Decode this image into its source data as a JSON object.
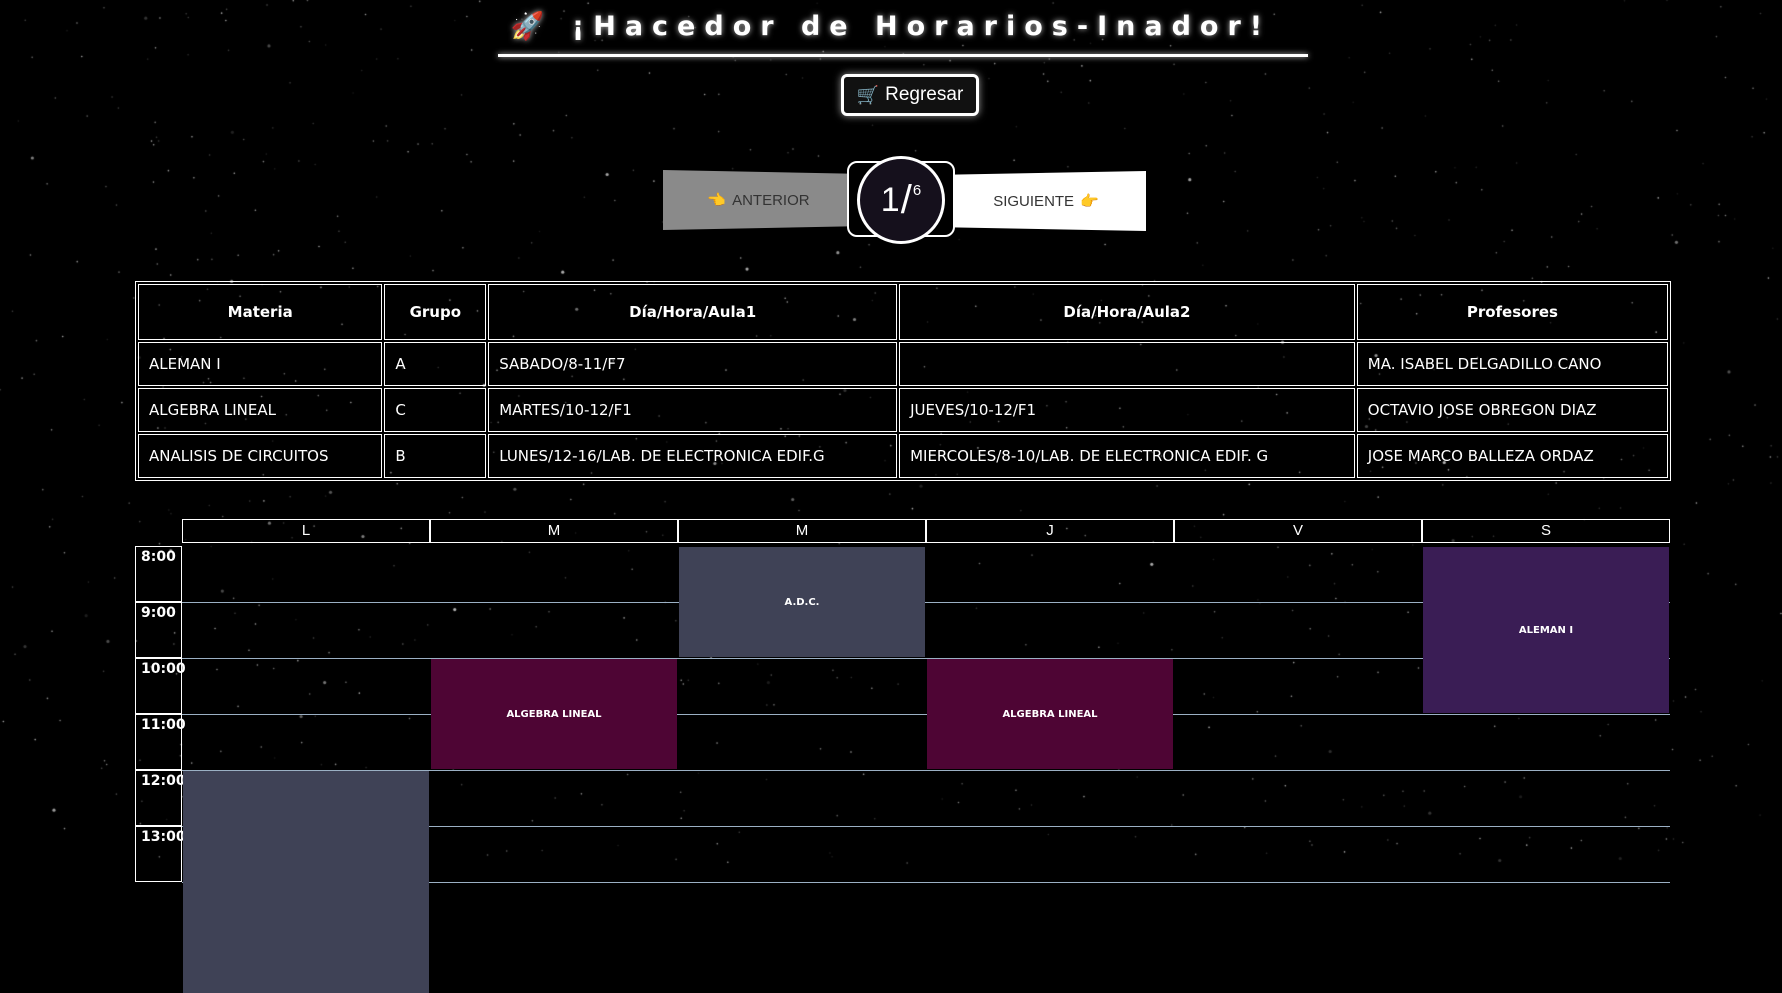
{
  "app": {
    "title": "🚀 ¡Hacedor de Horarios-Inador!",
    "back_icon": "🛒",
    "back_label": "Regresar"
  },
  "pager": {
    "prev_icon": "👈",
    "prev_label": "ANTERIOR",
    "next_label": "SIGUIENTE",
    "next_icon": "👉",
    "current": "1",
    "slash": "/",
    "total": "6"
  },
  "subjects_table": {
    "headers": [
      "Materia",
      "Grupo",
      "Día/Hora/Aula1",
      "Día/Hora/Aula2",
      "Profesores"
    ],
    "rows": [
      [
        "ALEMAN I",
        "A",
        "SABADO/8-11/F7",
        "",
        "MA. ISABEL DELGADILLO CANO"
      ],
      [
        "ALGEBRA LINEAL",
        "C",
        "MARTES/10-12/F1",
        "JUEVES/10-12/F1",
        "OCTAVIO JOSE OBREGON DIAZ"
      ],
      [
        "ANALISIS DE CIRCUITOS",
        "B",
        "LUNES/12-16/LAB. DE ELECTRONICA EDIF.G",
        "MIERCOLES/8-10/LAB. DE ELECTRONICA EDIF. G",
        "JOSE MARCO BALLEZA ORDAZ"
      ]
    ]
  },
  "schedule": {
    "days": [
      "L",
      "M",
      "M",
      "J",
      "V",
      "S"
    ],
    "times": [
      "8:00",
      "9:00",
      "10:00",
      "11:00",
      "12:00",
      "13:00"
    ],
    "blocks": [
      {
        "label": "A.D.C.",
        "day": 2,
        "start": 8,
        "end": 10,
        "color": "#3f4256"
      },
      {
        "label": "ALEMAN I",
        "day": 5,
        "start": 8,
        "end": 11,
        "color": "#3a1d55"
      },
      {
        "label": "ALGEBRA LINEAL",
        "day": 1,
        "start": 10,
        "end": 12,
        "color": "#4e0534"
      },
      {
        "label": "ALGEBRA LINEAL",
        "day": 3,
        "start": 10,
        "end": 12,
        "color": "#4e0534"
      },
      {
        "label": "",
        "day": 0,
        "start": 12,
        "end": 16,
        "color": "#3f4256"
      }
    ]
  }
}
